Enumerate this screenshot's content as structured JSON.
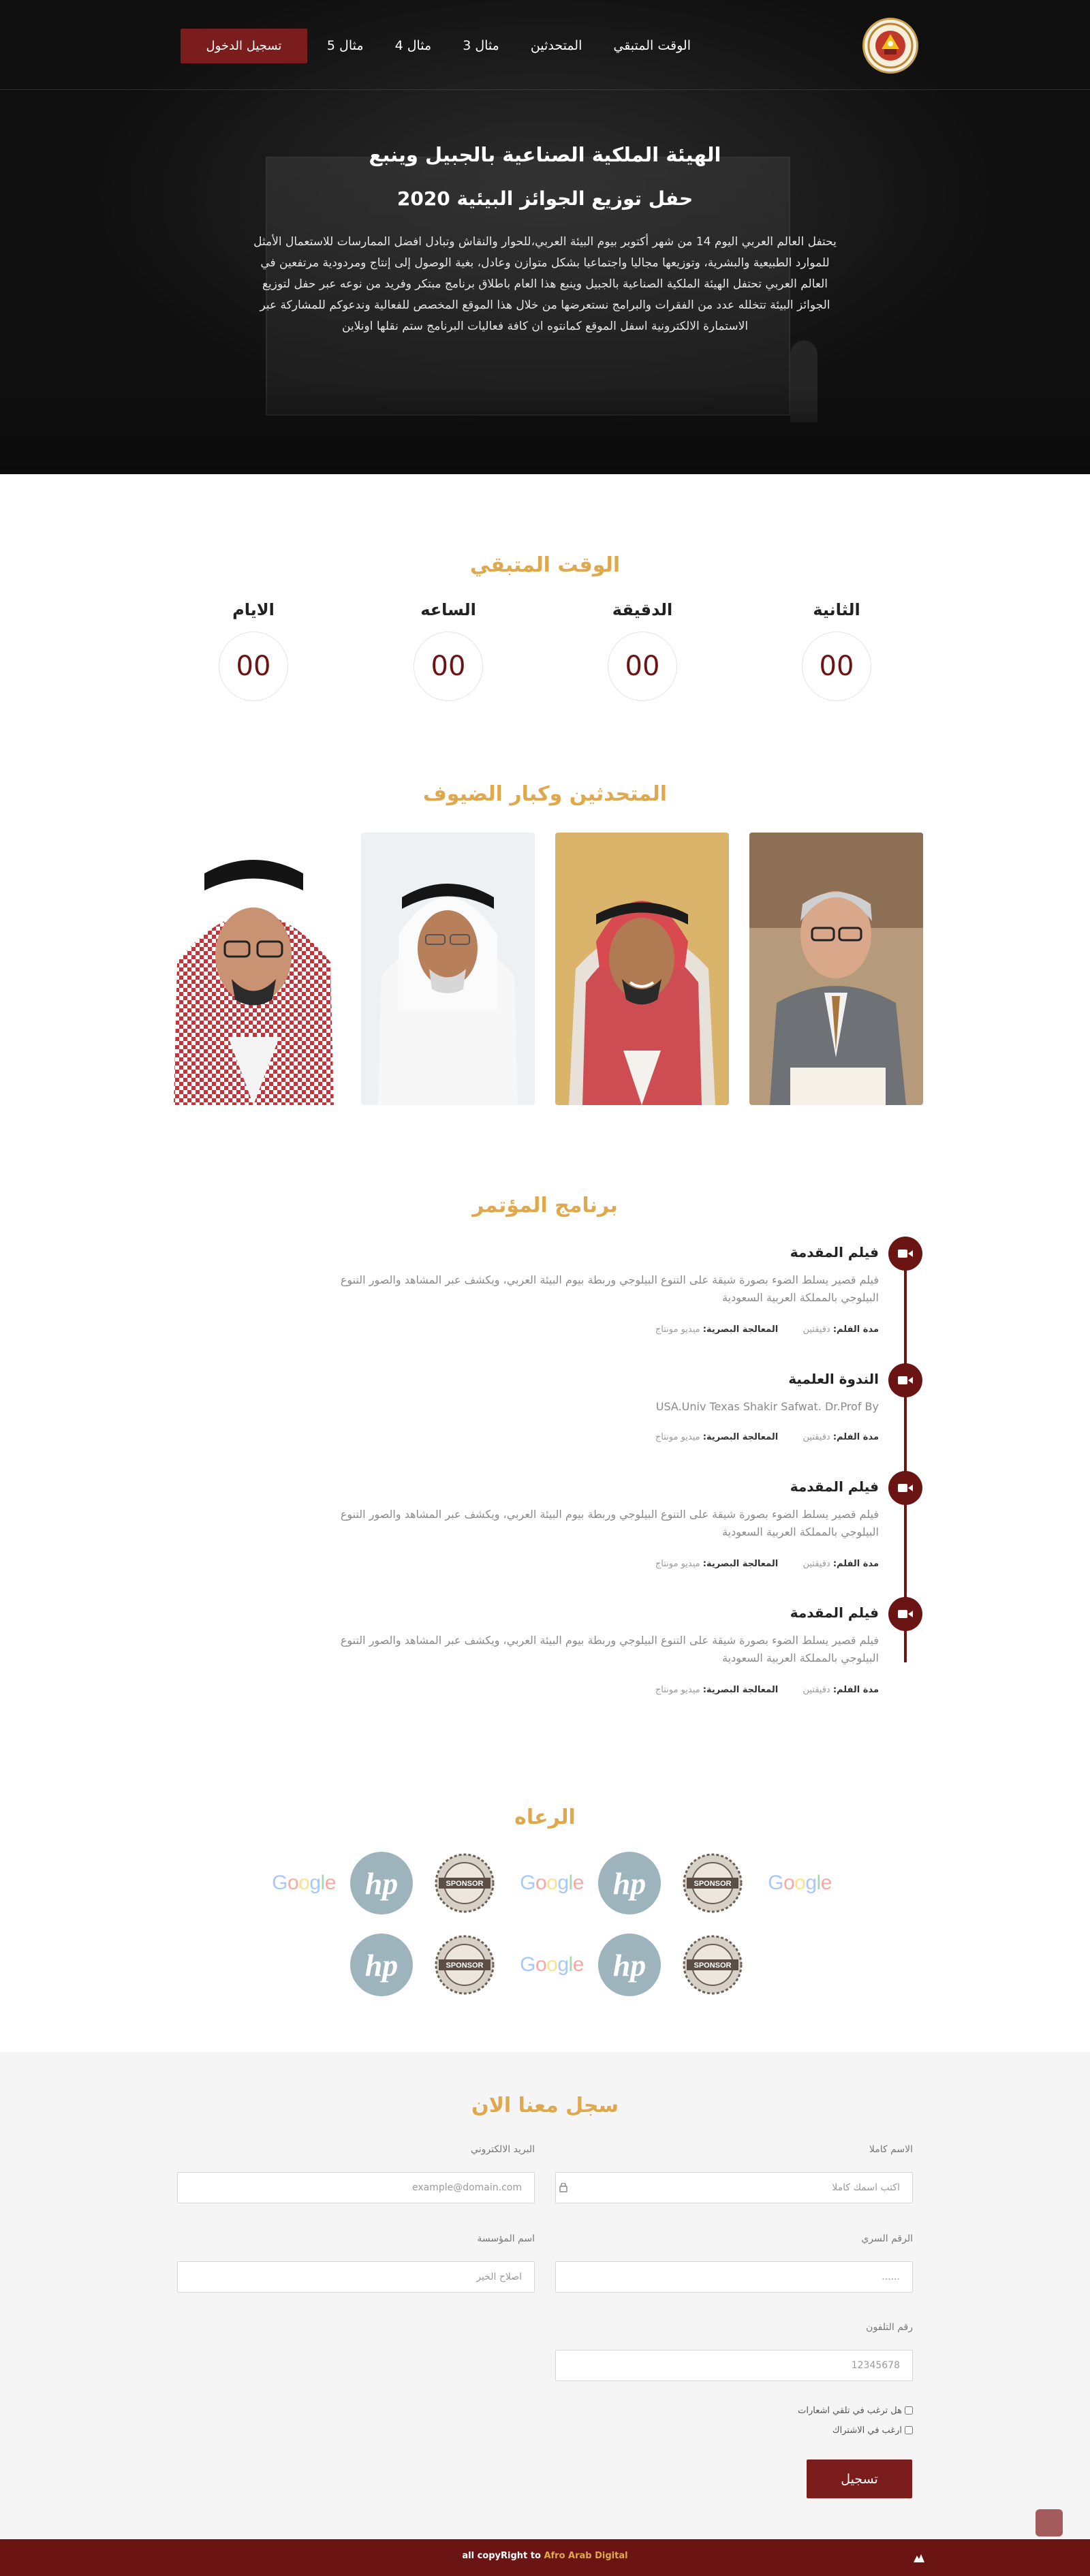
{
  "nav": {
    "items": [
      "الوقت المتبقي",
      "المتحدثين",
      "مثال 3",
      "مثال 4",
      "مثال 5"
    ],
    "login_label": "تسجيل الدخول"
  },
  "hero": {
    "title": "الهيئة الملكية الصناعية بالجبيل وينبع",
    "subtitle": "حفل توزيع الجوائز البيئية 2020",
    "description": "يحتفل العالم العربي اليوم 14 من شهر أكتوبر بيوم البيئة العربي،للحوار والنقاش وتبادل افضل الممارسات للاستعمال الأمثل للموارد الطبيعية والبشرية، وتوزيعها مجاليا واجتماعيا بشكل متوازن وعادل، بغية الوصول إلى إنتاج ومردودية مرتفعين في العالم العربي تحتفل الهيئة الملكية الصناعية بالجبيل وينبع هذا العام باطلاق برنامج مبتكر وفريد من نوعه عبر حفل لتوزيع الجوائز البيئة تتخلله عدد من الفقرات والبرامج نستعرضها من خلال هذا الموقع المخصص للفعالية وندعوكم للمشاركة عبر الاستمارة الالكترونية اسفل الموقع كمانتوه ان كافة فعاليات البرنامج ستم نقلها اونلاين"
  },
  "countdown": {
    "title": "الوقت المتبقي",
    "units": [
      {
        "label": "الثانية",
        "value": "00"
      },
      {
        "label": "الدقيقة",
        "value": "00"
      },
      {
        "label": "الساعه",
        "value": "00"
      },
      {
        "label": "الايام",
        "value": "00"
      }
    ]
  },
  "speakers": {
    "title": "المتحدثين وكبار الضيوف"
  },
  "program": {
    "title": "برنامج المؤتمر",
    "items": [
      {
        "title": "فيلم المقدمة",
        "description": "فيلم قصير يسلط الضوء بصورة شيقة على التنوع البيلوجي وربطة بيوم البيئة العربي، ويكشف عبر المشاهد والصور التنوع البيلوجي بالمملكة العربية السعودية",
        "duration_label": "مدة الفلم:",
        "duration_value": "دقيقتين",
        "producer_label": "المعالجة البصرية:",
        "producer_value": "ميديو مونتاج"
      },
      {
        "title": "الندوة العلمية",
        "description": "USA.Univ Texas Shakir Safwat. Dr.Prof By",
        "duration_label": "مدة الفلم:",
        "duration_value": "دقيقتين",
        "producer_label": "المعالجة البصرية:",
        "producer_value": "ميديو مونتاج"
      },
      {
        "title": "فيلم المقدمة",
        "description": "فيلم قصير يسلط الضوء بصورة شيقة على التنوع البيلوجي وربطة بيوم البيئة العربي، ويكشف عبر المشاهد والصور التنوع البيلوجي بالمملكة العربية السعودية",
        "duration_label": "مدة الفلم:",
        "duration_value": "دقيقتين",
        "producer_label": "المعالجة البصرية:",
        "producer_value": "ميديو مونتاج"
      },
      {
        "title": "فيلم المقدمة",
        "description": "فيلم قصير يسلط الضوء بصورة شيقة على التنوع البيلوجي وربطة بيوم البيئة العربي، ويكشف عبر المشاهد والصور التنوع البيلوجي بالمملكة العربية السعودية",
        "duration_label": "مدة الفلم:",
        "duration_value": "دقيقتين",
        "producer_label": "المعالجة البصرية:",
        "producer_value": "ميديو مونتاج"
      }
    ]
  },
  "sponsors": {
    "title": "الرعاه",
    "google_text": "Google",
    "hp_text": "hp",
    "seal_text": "SPONSOR"
  },
  "register": {
    "title": "سجل معنا الان",
    "full_name_label": "الاسم كاملا",
    "full_name_placeholder": "اكتب اسمك كاملا",
    "email_label": "البريد الالكتروني",
    "email_placeholder": "example@domain.com",
    "password_label": "الرقم السري",
    "password_placeholder": "......",
    "org_label": "اسم المؤسسة",
    "org_placeholder": "اصلاح الخير",
    "phone_label": "رقم التلفون",
    "phone_placeholder": "12345678",
    "checkbox_notifications": "هل ترغب في تلقي اشعارات",
    "checkbox_subscribe": "ارغب في الاشتراك",
    "submit_label": "تسجيل"
  },
  "footer": {
    "text": "all copyRight to ",
    "brand": "Afro Arab Digital"
  },
  "colors": {
    "accent": "#e0a84d",
    "brand": "#7c1d1d",
    "footer": "#6b1414"
  }
}
